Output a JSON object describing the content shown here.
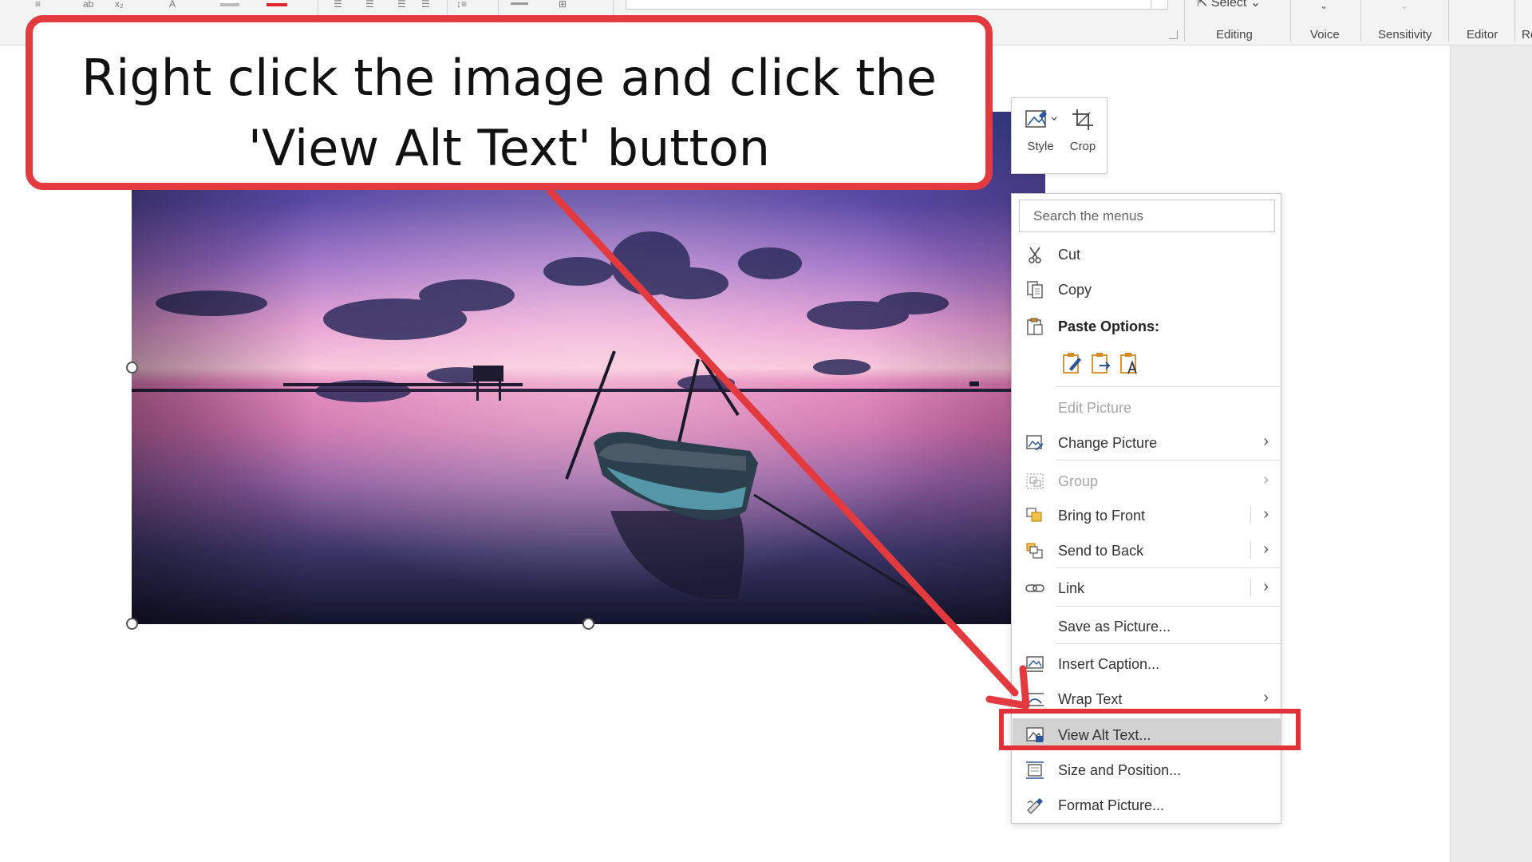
{
  "ribbon": {
    "select_label": "Select",
    "groups": [
      "Editing",
      "Voice",
      "Sensitivity",
      "Editor",
      "Re"
    ]
  },
  "callout": {
    "text": "Right click the image and click the\n'View Alt Text' button"
  },
  "mini_toolbar": {
    "style_label": "Style",
    "crop_label": "Crop"
  },
  "context_menu": {
    "search_placeholder": "Search the menus",
    "cut": "Cut",
    "copy": "Copy",
    "paste_options": "Paste Options:",
    "edit_picture": "Edit Picture",
    "change_picture": "Change Picture",
    "group": "Group",
    "bring_to_front": "Bring to Front",
    "send_to_back": "Send to Back",
    "link": "Link",
    "save_as_picture": "Save as Picture...",
    "insert_caption": "Insert Caption...",
    "wrap_text": "Wrap Text",
    "view_alt_text": "View Alt Text...",
    "size_and_position": "Size and Position...",
    "format_picture": "Format Picture..."
  },
  "colors": {
    "annotation_red": "#e23a3f",
    "menu_highlight": "#d2d2d2",
    "icon_blue": "#2b579a",
    "paste_orange": "#d68a1e"
  },
  "icons": {
    "cut": "scissors-icon",
    "copy": "copy-icon",
    "paste": "clipboard-icon",
    "change_picture": "change-picture-icon",
    "group": "group-icon",
    "bring_to_front": "bring-to-front-icon",
    "send_to_back": "send-to-back-icon",
    "link": "link-icon",
    "insert_caption": "caption-icon",
    "wrap_text": "wrap-text-icon",
    "view_alt_text": "alt-text-icon",
    "size_and_position": "size-position-icon",
    "format_picture": "format-picture-icon"
  }
}
